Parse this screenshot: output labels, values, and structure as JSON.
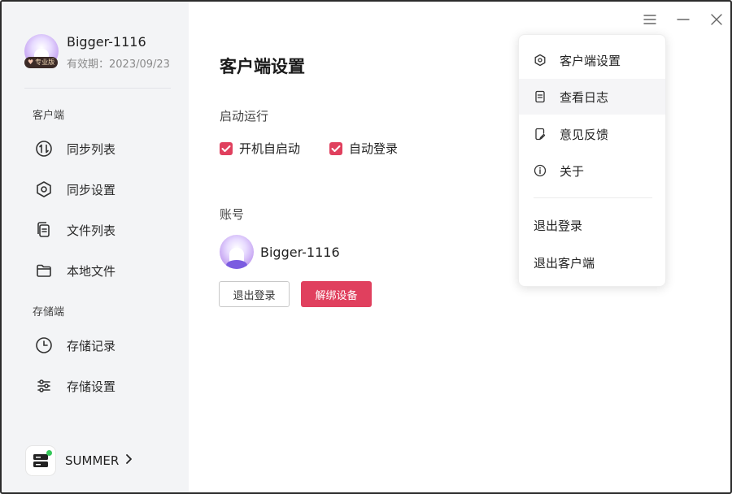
{
  "profile": {
    "name": "Bigger-1116",
    "expire": "有效期：2023/09/23",
    "badge": "专业版"
  },
  "sidebar": {
    "section_client": "客户端",
    "section_storage": "存储端",
    "items": [
      {
        "label": "同步列表",
        "icon": "sync-icon"
      },
      {
        "label": "同步设置",
        "icon": "hexagon-settings-icon"
      },
      {
        "label": "文件列表",
        "icon": "file-list-icon"
      },
      {
        "label": "本地文件",
        "icon": "folder-icon"
      },
      {
        "label": "存储记录",
        "icon": "clock-icon"
      },
      {
        "label": "存储设置",
        "icon": "sliders-icon"
      }
    ],
    "server": {
      "label": "SUMMER",
      "status_color": "#34c759"
    }
  },
  "main": {
    "title": "客户端设置",
    "startup": {
      "label": "启动运行",
      "auto_start": {
        "label": "开机自启动",
        "checked": true
      },
      "auto_login": {
        "label": "自动登录",
        "checked": true
      }
    },
    "account": {
      "label": "账号",
      "name": "Bigger-1116",
      "logout_label": "退出登录",
      "unbind_label": "解绑设备"
    }
  },
  "menu": {
    "items": [
      {
        "label": "客户端设置",
        "icon": "hexagon-settings-icon"
      },
      {
        "label": "查看日志",
        "icon": "document-icon"
      },
      {
        "label": "意见反馈",
        "icon": "feedback-icon"
      },
      {
        "label": "关于",
        "icon": "info-icon"
      }
    ],
    "logout": "退出登录",
    "quit": "退出客户端"
  },
  "colors": {
    "accent": "#e0405e",
    "sidebar_bg": "#f3f4f6"
  }
}
